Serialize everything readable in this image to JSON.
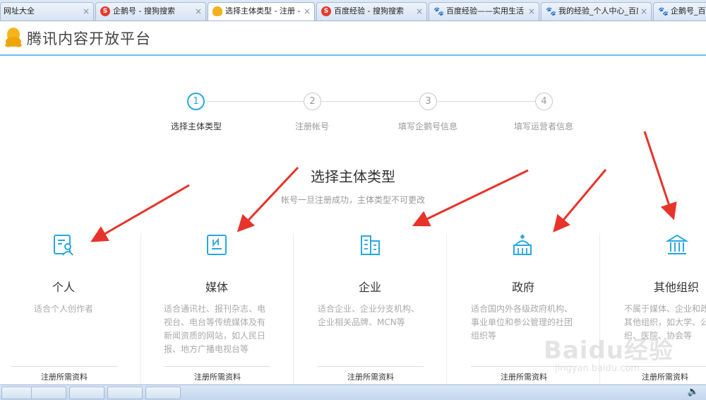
{
  "browser": {
    "tabs": [
      {
        "label": "网址大全",
        "icon": "none"
      },
      {
        "label": "企鹅号 - 搜狗搜索",
        "icon": "sogou"
      },
      {
        "label": "选择主体类型 - 注册 - 腾",
        "icon": "qq"
      },
      {
        "label": "百度经验 - 搜狗搜索",
        "icon": "sogou"
      },
      {
        "label": "百度经验——实用生活",
        "icon": "baidu"
      },
      {
        "label": "我的经验_个人中心_百度",
        "icon": "baidu"
      },
      {
        "label": "企鹅号_百度",
        "icon": "baidu"
      }
    ],
    "close_glyph": "×",
    "active_tab_index": 2
  },
  "header": {
    "site_title": "腾讯内容开放平台",
    "logo_icon": "penguin-icon"
  },
  "steps": [
    {
      "number": "1",
      "label": "选择主体类型",
      "active": true
    },
    {
      "number": "2",
      "label": "注册帐号",
      "active": false
    },
    {
      "number": "3",
      "label": "填写企鹅号信息",
      "active": false
    },
    {
      "number": "4",
      "label": "填写运营者信息",
      "active": false
    }
  ],
  "section": {
    "title": "选择主体类型",
    "subtitle": "帐号一旦注册成功，主体类型不可更改"
  },
  "cards": [
    {
      "name": "个人",
      "icon": "person-id-icon",
      "desc": "适合个人创作者",
      "footer": "注册所需资料"
    },
    {
      "name": "媒体",
      "icon": "newspaper-icon",
      "desc": "适合通讯社、报刊杂志、电视台、电台等传统媒体及有新闻资质的网站，如人民日报、地方广播电视台等",
      "footer": "注册所需资料"
    },
    {
      "name": "企业",
      "icon": "office-building-icon",
      "desc": "适合企业、企业分支机构、企业相关品牌、MCN等",
      "footer": "注册所需资料"
    },
    {
      "name": "政府",
      "icon": "government-dome-icon",
      "desc": "适合国内外各级政府机构、事业单位和参公管理的社团组织等",
      "footer": "注册所需资料"
    },
    {
      "name": "其他组织",
      "icon": "institution-columns-icon",
      "desc": "不属于媒体、企业和政府的其他组织，如大学、公益组织、医院、协会等",
      "footer": "注册所需资料"
    }
  ],
  "watermark": {
    "text": "Baidu经验",
    "url": "jingyan.baidu.com"
  },
  "taskbar": {
    "tray_icon": "speaker-icon",
    "tray_glyph": "🔈"
  },
  "colors": {
    "accent": "#29a8e0",
    "annotation": "#e8332a",
    "header_line": "#6cc0ea"
  }
}
